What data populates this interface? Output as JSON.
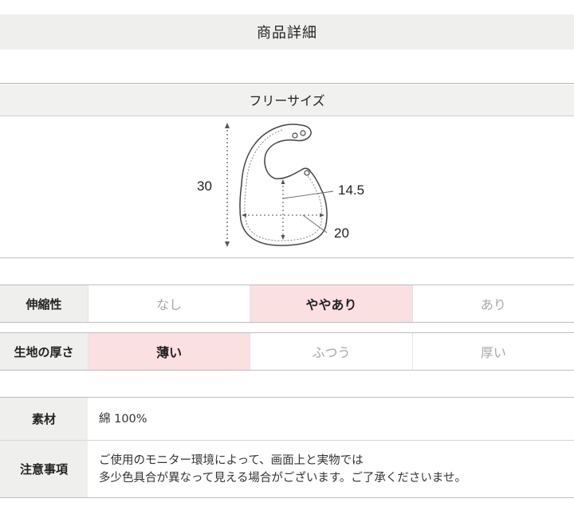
{
  "page_title": "商品詳細",
  "size_section": {
    "header": "フリーサイズ",
    "dimensions": {
      "height": "30",
      "neck": "14.5",
      "width": "20"
    }
  },
  "scales": [
    {
      "label": "伸縮性",
      "options": [
        "なし",
        "ややあり",
        "あり"
      ],
      "selected": "ややあり"
    },
    {
      "label": "生地の厚さ",
      "options": [
        "薄い",
        "ふつう",
        "厚い"
      ],
      "selected": "薄い"
    }
  ],
  "specs": {
    "material": {
      "label": "素材",
      "value": "綿 100%"
    },
    "notes": {
      "label": "注意事項",
      "line1": "ご使用のモニター環境によって、画面上と実物では",
      "line2": "多少色具合が異なって見える場合がございます。ご了承くださいませ。"
    }
  },
  "colors": {
    "header_bg": "#efefed",
    "selected_bg": "#fbe0e2",
    "inactive_text": "#a8a8a8"
  }
}
